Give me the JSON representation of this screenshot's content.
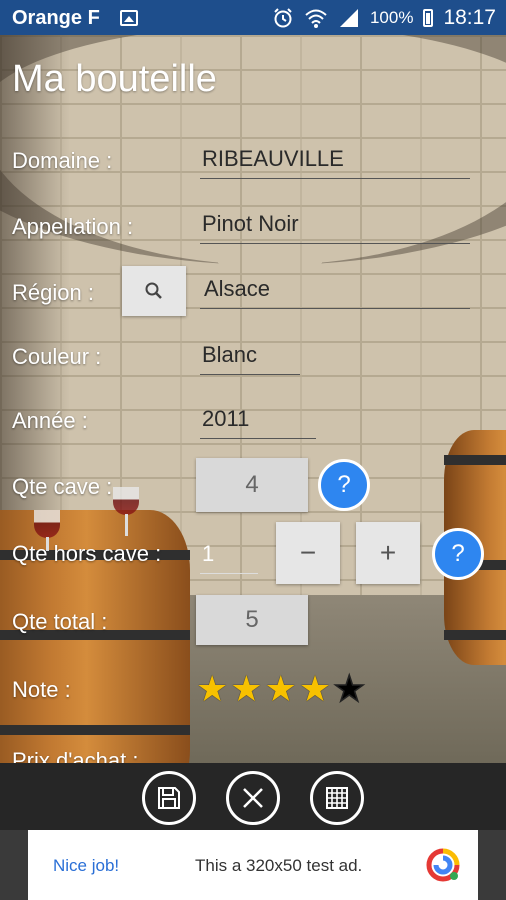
{
  "status_bar": {
    "carrier": "Orange F",
    "battery": "100%",
    "time": "18:17"
  },
  "page": {
    "title": "Ma bouteille"
  },
  "fields": {
    "domaine": {
      "label": "Domaine :",
      "value": "RIBEAUVILLE"
    },
    "appellation": {
      "label": "Appellation :",
      "value": "Pinot Noir"
    },
    "region": {
      "label": "Région :",
      "value": "Alsace"
    },
    "couleur": {
      "label": "Couleur :",
      "value": "Blanc"
    },
    "annee": {
      "label": "Année :",
      "value": "2011"
    },
    "qte_cave": {
      "label": "Qte cave :",
      "value": "4",
      "help": "?"
    },
    "qte_hors_cave": {
      "label": "Qte hors cave :",
      "value": "1",
      "minus": "−",
      "plus": "+",
      "help": "?"
    },
    "qte_total": {
      "label": "Qte total :",
      "value": "5"
    },
    "note": {
      "label": "Note :",
      "rating": 4,
      "max": 5
    },
    "prix_achat": {
      "label": "Prix d'achat :"
    }
  },
  "toolbar": {
    "save_icon": "save-icon",
    "cancel_icon": "close-icon",
    "grid_icon": "grid-icon"
  },
  "ad": {
    "left_text": "Nice job!",
    "message": "This a 320x50 test ad."
  },
  "colors": {
    "status_bar": "#1e4e8c",
    "help_button": "#2e86f0",
    "star": "#f7c100",
    "toolbar": "#262626",
    "ad_link": "#2a6fd6"
  }
}
